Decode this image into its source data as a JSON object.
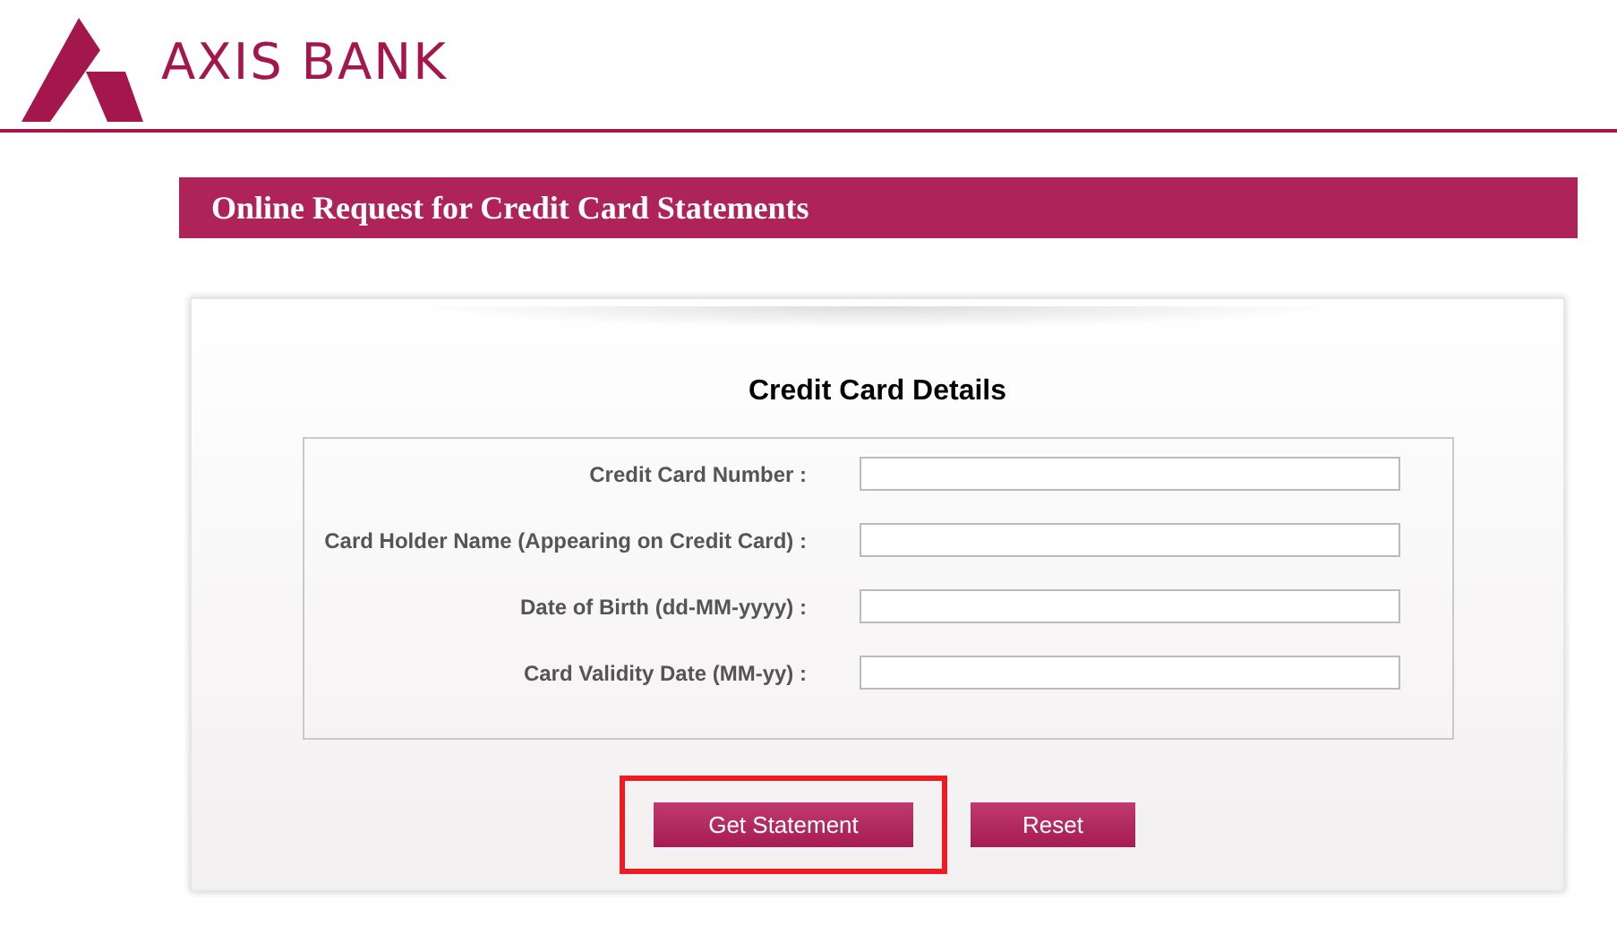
{
  "header": {
    "logo_text": "AXIS BANK"
  },
  "page_title": "Online Request for Credit Card Statements",
  "form": {
    "title": "Credit Card Details",
    "fields": [
      {
        "label": "Credit Card Number :"
      },
      {
        "label": "Card Holder Name (Appearing on Credit Card) :"
      },
      {
        "label": "Date of Birth (dd-MM-yyyy) :"
      },
      {
        "label": "Card Validity Date (MM-yy) :"
      }
    ],
    "buttons": [
      {
        "label": "Get Statement",
        "highlighted": true
      },
      {
        "label": "Reset",
        "highlighted": false
      }
    ]
  }
}
